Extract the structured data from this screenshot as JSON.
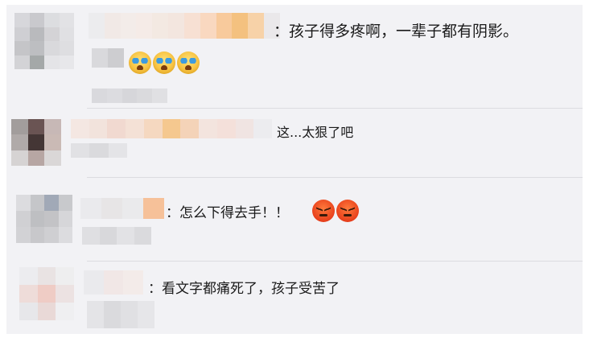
{
  "comments": [
    {
      "text": "：孩子得多疼啊，一辈子都有阴影。",
      "emojis": [
        "crying-face",
        "crying-face",
        "crying-face"
      ]
    },
    {
      "text": "这...太狠了吧",
      "emojis": []
    },
    {
      "text": "：怎么下得去手！！",
      "emojis": [
        "angry-face",
        "angry-face"
      ]
    },
    {
      "text": "：看文字都痛死了，孩子受苦了",
      "emojis": []
    }
  ],
  "colors": {
    "panel_background": "#f2f2f5",
    "text": "#1a1a1a",
    "divider": "#dcdce0"
  }
}
